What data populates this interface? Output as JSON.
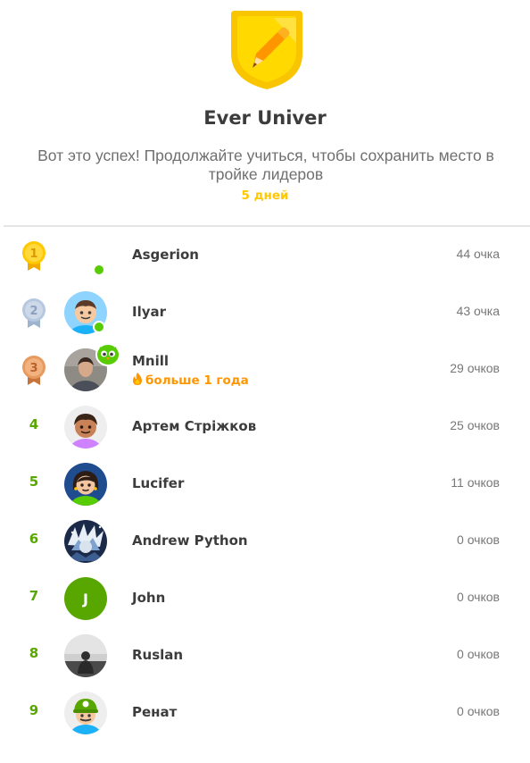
{
  "league": {
    "title": "Ever Univer",
    "message": "Вот это успех! Продолжайте учиться, чтобы сохранить место в тройке лидеров",
    "days_left": "5 дней",
    "badge_icon": "pencil-shield-badge-icon"
  },
  "colors": {
    "gold": "#ffc800",
    "green": "#58a700",
    "online": "#58cc02",
    "streak": "#ff9600"
  },
  "leaderboard": [
    {
      "rank": "1",
      "name": "Asgerion",
      "points": "44 очка",
      "medal": "gold-medal-icon",
      "online": true
    },
    {
      "rank": "2",
      "name": "Ilyar",
      "points": "43 очка",
      "medal": "silver-medal-icon",
      "online": true
    },
    {
      "rank": "3",
      "name": "Mnill",
      "points": "29 очков",
      "medal": "bronze-medal-icon",
      "streak": "больше 1 года"
    },
    {
      "rank": "4",
      "name": "Артем Стріжков",
      "points": "25 очков"
    },
    {
      "rank": "5",
      "name": "Lucifer",
      "points": "11 очков"
    },
    {
      "rank": "6",
      "name": "Andrew Python",
      "points": "0 очков"
    },
    {
      "rank": "7",
      "name": "John",
      "points": "0 очков",
      "initial": "J"
    },
    {
      "rank": "8",
      "name": "Ruslan",
      "points": "0 очков"
    },
    {
      "rank": "9",
      "name": "Ренат",
      "points": "0 очков"
    }
  ]
}
